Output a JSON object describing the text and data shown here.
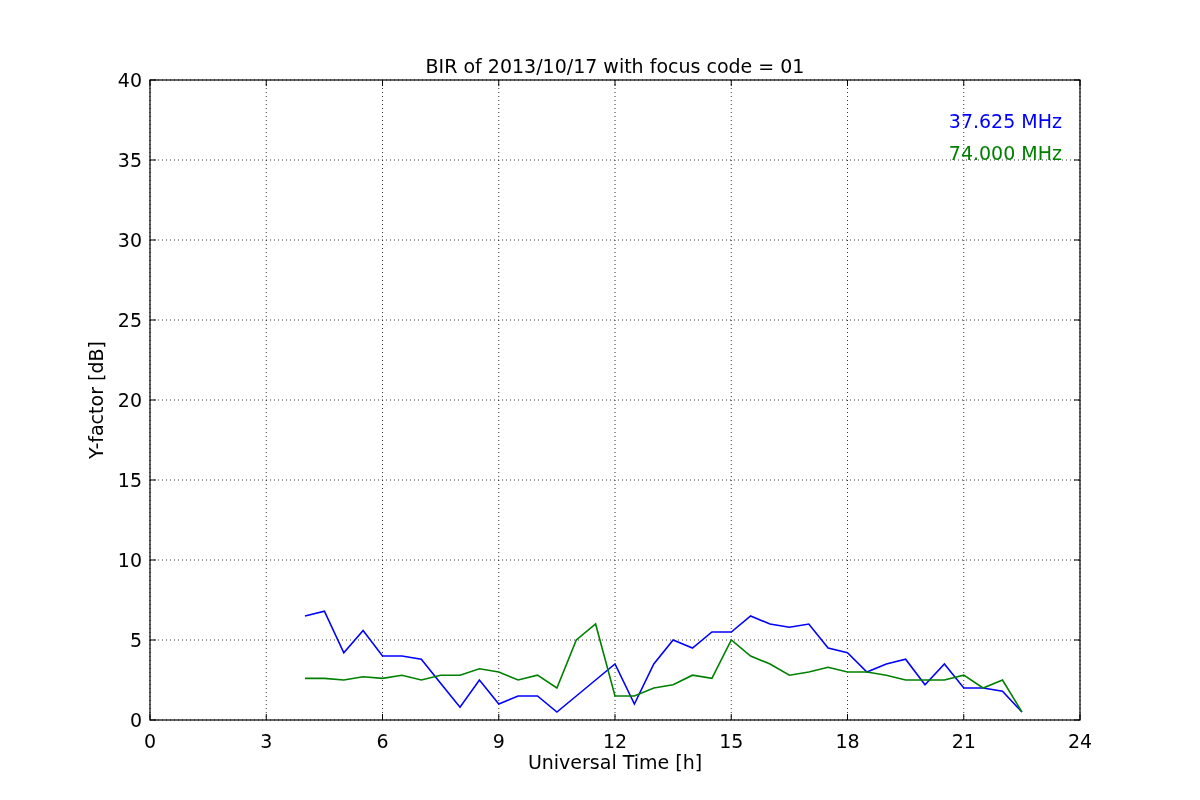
{
  "figure": {
    "chart_data": {
      "type": "line",
      "title": "BIR of 2013/10/17 with focus code = 01",
      "xlabel": "Universal Time [h]",
      "ylabel": "Y-factor [dB]",
      "x": [
        4,
        4.5,
        5,
        5.5,
        6,
        6.5,
        7,
        7.5,
        8,
        8.5,
        9,
        9.5,
        10,
        10.5,
        11,
        11.5,
        12,
        12.5,
        13,
        13.5,
        14,
        14.5,
        15,
        15.5,
        16,
        16.5,
        17,
        17.5,
        18,
        18.5,
        19,
        19.5,
        20,
        20.5,
        21,
        21.5,
        22,
        22.5
      ],
      "series": [
        {
          "name": "37.625 MHz",
          "color": "#0000ff",
          "values": [
            6.5,
            6.8,
            4.2,
            5.6,
            4.0,
            4.0,
            3.8,
            2.3,
            0.8,
            2.5,
            1.0,
            1.5,
            1.5,
            0.5,
            1.5,
            2.5,
            3.5,
            1.0,
            3.5,
            5.0,
            4.5,
            5.5,
            5.5,
            6.5,
            6.0,
            5.8,
            6.0,
            4.5,
            4.2,
            3.0,
            3.5,
            3.8,
            2.2,
            3.5,
            2.0,
            2.0,
            1.8,
            0.5
          ]
        },
        {
          "name": "74.000 MHz",
          "color": "#008000",
          "values": [
            2.6,
            2.6,
            2.5,
            2.7,
            2.6,
            2.8,
            2.5,
            2.8,
            2.8,
            3.2,
            3.0,
            2.5,
            2.8,
            2.0,
            5.0,
            6.0,
            1.5,
            1.5,
            2.0,
            2.2,
            2.8,
            2.6,
            5.0,
            4.0,
            3.5,
            2.8,
            3.0,
            3.3,
            3.0,
            3.0,
            2.8,
            2.5,
            2.5,
            2.5,
            2.8,
            2.0,
            2.5,
            0.5
          ]
        }
      ],
      "grid": true,
      "xlim": [
        0,
        24
      ],
      "ylim": [
        0,
        40
      ],
      "xticks": [
        0,
        3,
        6,
        9,
        12,
        15,
        18,
        21,
        24
      ],
      "yticks": [
        0,
        5,
        10,
        15,
        20,
        25,
        30,
        35,
        40
      ]
    }
  }
}
